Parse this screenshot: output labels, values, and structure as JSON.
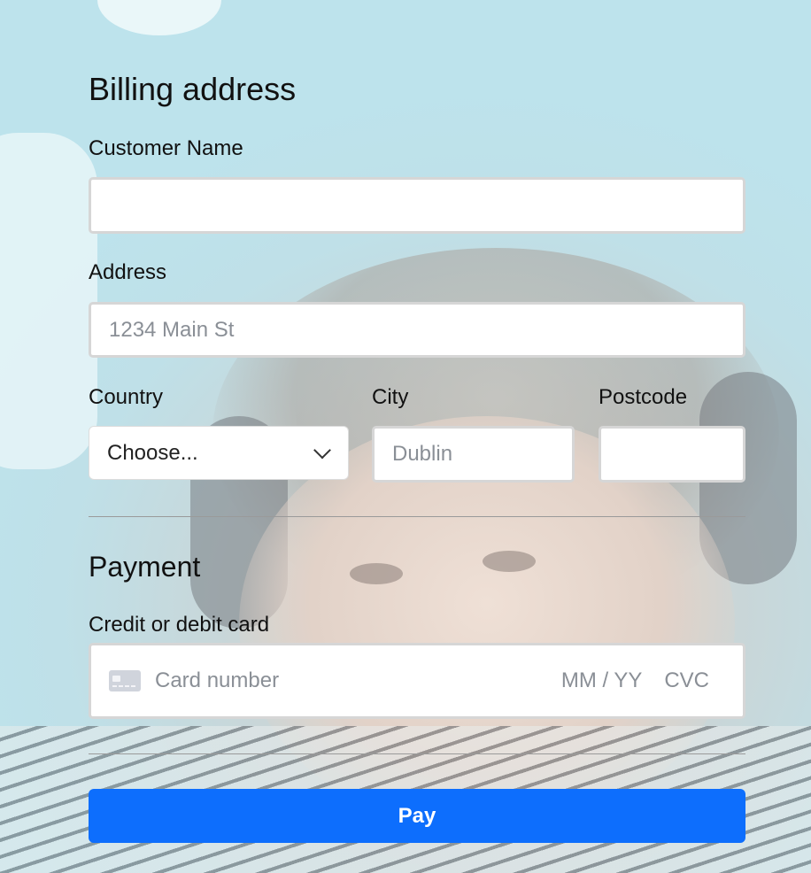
{
  "billing": {
    "heading": "Billing address",
    "customer_name": {
      "label": "Customer Name",
      "value": "",
      "placeholder": ""
    },
    "address": {
      "label": "Address",
      "value": "",
      "placeholder": "1234 Main St"
    },
    "country": {
      "label": "Country",
      "selected": "Choose..."
    },
    "city": {
      "label": "City",
      "value": "",
      "placeholder": "Dublin"
    },
    "postcode": {
      "label": "Postcode",
      "value": "",
      "placeholder": ""
    }
  },
  "payment": {
    "heading": "Payment",
    "card_label": "Credit or debit card",
    "card_number_placeholder": "Card number",
    "expiry_placeholder": "MM / YY",
    "cvc_placeholder": "CVC",
    "card_icon": "credit-card-icon"
  },
  "actions": {
    "pay_label": "Pay"
  },
  "colors": {
    "primary": "#0d6efd",
    "background_tint": "#b9dde6"
  }
}
